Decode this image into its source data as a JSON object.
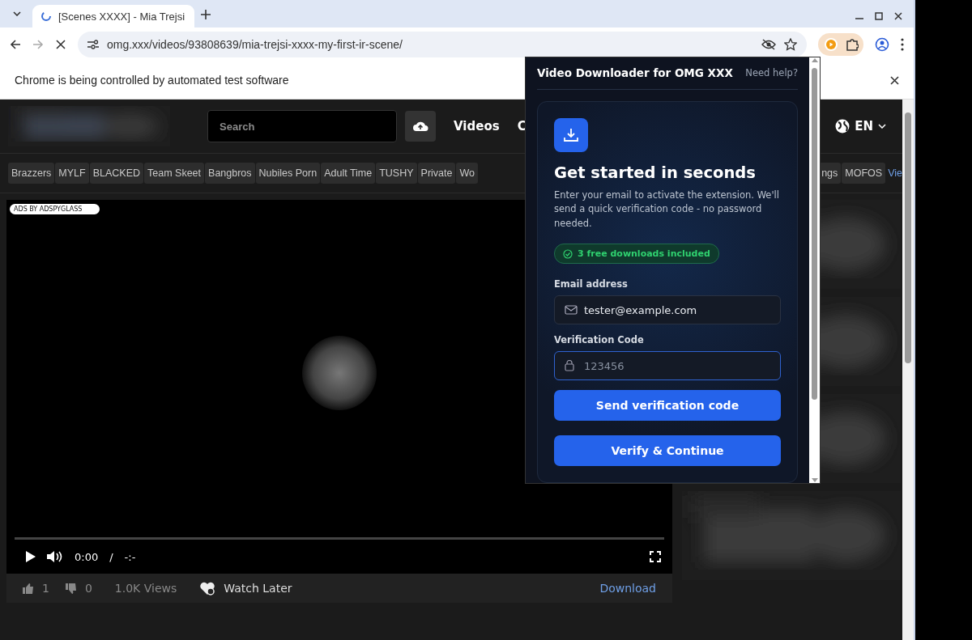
{
  "browser": {
    "tabs": [
      {
        "title": "[Scenes XXXX] - Mia Trejsi",
        "selected": true
      }
    ],
    "url": "omg.xxx/videos/93808639/mia-trejsi-xxxx-my-first-ir-scene/",
    "infobar": "Chrome is being controlled by automated test software"
  },
  "site": {
    "search_placeholder": "Search",
    "nav": [
      "Videos",
      "C"
    ],
    "language": "EN",
    "categories_left": [
      "Brazzers",
      "MYLF",
      "BLACKED",
      "Team Skeet",
      "Bangbros",
      "Nubiles Porn",
      "Adult Time",
      "TUSHY",
      "Private",
      "Wo"
    ],
    "categories_right": [
      {
        "label": "ngs",
        "kind": "tag"
      },
      {
        "label": "MOFOS",
        "kind": "tag"
      },
      {
        "label": "Vie",
        "kind": "link"
      }
    ],
    "ad_label": "ADS BY ADSPYGLASS",
    "player": {
      "time": "0:00",
      "separator": "/",
      "duration": "-:-"
    },
    "stats": {
      "likes": "1",
      "dislikes": "0",
      "views": "1.0K Views",
      "watch_later": "Watch Later",
      "download": "Download"
    }
  },
  "popup": {
    "title": "Video Downloader for OMG XXX",
    "help": "Need help?",
    "heading": "Get started in seconds",
    "description": "Enter your email to activate the extension. We'll send a quick verification code - no password needed.",
    "badge": "3 free downloads included",
    "email_label": "Email address",
    "email_value": "tester@example.com",
    "code_label": "Verification Code",
    "code_placeholder": "123456",
    "code_focused": true,
    "send_button": "Send verification code",
    "verify_button": "Verify & Continue"
  }
}
